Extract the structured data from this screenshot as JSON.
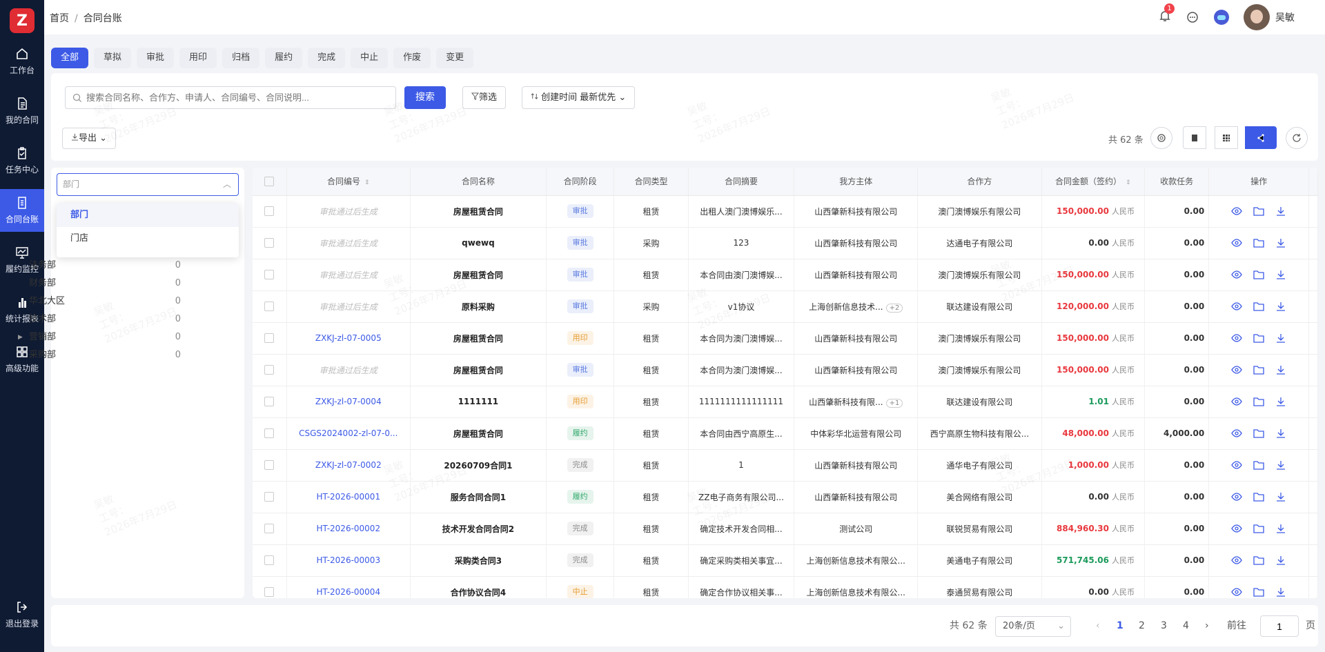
{
  "sidebar": {
    "items": [
      {
        "label": "工作台",
        "icon": "home-icon"
      },
      {
        "label": "我的合同",
        "icon": "document-icon"
      },
      {
        "label": "任务中心",
        "icon": "clipboard-icon"
      },
      {
        "label": "合同台账",
        "icon": "ledger-icon",
        "active": true
      },
      {
        "label": "履约监控",
        "icon": "monitor-icon"
      },
      {
        "label": "统计报表",
        "icon": "bar-chart-icon"
      },
      {
        "label": "高级功能",
        "icon": "grid-icon"
      }
    ],
    "logout": "退出登录"
  },
  "header": {
    "crumb_home": "首页",
    "crumb_sep": "/",
    "crumb_current": "合同台账",
    "notify_count": "1",
    "user_name": "吴敏"
  },
  "tabs": [
    "全部",
    "草拟",
    "审批",
    "用印",
    "归档",
    "履约",
    "完成",
    "中止",
    "作废",
    "变更"
  ],
  "toolbar": {
    "search_placeholder": "搜索合同名称、合作方、申请人、合同编号、合同说明...",
    "search_btn": "搜索",
    "filter_btn": "筛选",
    "sort_btn": "创建时间 最新优先",
    "export_btn": "导出",
    "total": "共 62 条"
  },
  "dept": {
    "placeholder": "部门",
    "options": [
      "部门",
      "门店"
    ],
    "tree": [
      {
        "label": "法务部",
        "count": "0"
      },
      {
        "label": "财务部",
        "count": "0"
      },
      {
        "label": "华北大区",
        "count": "0"
      },
      {
        "label": "技术部",
        "count": "0"
      },
      {
        "label": "营销部",
        "count": "0",
        "expandable": true
      },
      {
        "label": "采购部",
        "count": "0"
      }
    ]
  },
  "table": {
    "headers": [
      "合同编号",
      "合同名称",
      "合同阶段",
      "合同类型",
      "合同摘要",
      "我方主体",
      "合作方",
      "合同金额（签约）",
      "收款任务",
      "操作"
    ],
    "currency": "人民币",
    "rows": [
      {
        "code": "审批通过后生成",
        "pending": true,
        "name": "房屋租赁合同",
        "stage": "审批",
        "type": "租赁",
        "summary": "出租人澳门澳博娱乐...",
        "party": "山西肇新科技有限公司",
        "partner": "澳门澳博娱乐有限公司",
        "amount": "150,000.00",
        "amt_color": "#e8383d",
        "recv": "0.00"
      },
      {
        "code": "审批通过后生成",
        "pending": true,
        "name": "qwewq",
        "stage": "审批",
        "type": "采购",
        "summary": "123",
        "party": "山西肇新科技有限公司",
        "partner": "达通电子有限公司",
        "amount": "0.00",
        "amt_color": "#333",
        "recv": "0.00"
      },
      {
        "code": "审批通过后生成",
        "pending": true,
        "name": "房屋租赁合同",
        "stage": "审批",
        "type": "租赁",
        "summary": "本合同由澳门澳博娱...",
        "party": "山西肇新科技有限公司",
        "partner": "澳门澳博娱乐有限公司",
        "amount": "150,000.00",
        "amt_color": "#e8383d",
        "recv": "0.00"
      },
      {
        "code": "审批通过后生成",
        "pending": true,
        "name": "原料采购",
        "stage": "审批",
        "type": "采购",
        "summary": "v1协议",
        "party": "上海创新信息技术...",
        "party_more": "+2",
        "partner": "联达建设有限公司",
        "amount": "120,000.00",
        "amt_color": "#e8383d",
        "recv": "0.00"
      },
      {
        "code": "ZXKJ-zl-07-0005",
        "name": "房屋租赁合同",
        "stage": "用印",
        "type": "租赁",
        "summary": "本合同为澳门澳博娱...",
        "party": "山西肇新科技有限公司",
        "partner": "澳门澳博娱乐有限公司",
        "amount": "150,000.00",
        "amt_color": "#e8383d",
        "recv": "0.00"
      },
      {
        "code": "审批通过后生成",
        "pending": true,
        "name": "房屋租赁合同",
        "stage": "审批",
        "type": "租赁",
        "summary": "本合同为澳门澳博娱...",
        "party": "山西肇新科技有限公司",
        "partner": "澳门澳博娱乐有限公司",
        "amount": "150,000.00",
        "amt_color": "#e8383d",
        "recv": "0.00"
      },
      {
        "code": "ZXKJ-zl-07-0004",
        "name": "1111111",
        "stage": "用印",
        "type": "租赁",
        "summary": "1111111111111111",
        "party": "山西肇新科技有限...",
        "party_more": "+1",
        "partner": "联达建设有限公司",
        "amount": "1.01",
        "amt_color": "#1a9a5a",
        "recv": "0.00"
      },
      {
        "code": "CSGS2024002-zl-07-0...",
        "name": "房屋租赁合同",
        "stage": "履约",
        "type": "租赁",
        "summary": "本合同由西宁高原生...",
        "party": "中体彩华北运营有限公司",
        "partner": "西宁高原生物科技有限公...",
        "amount": "48,000.00",
        "amt_color": "#e8383d",
        "recv": "4,000.00"
      },
      {
        "code": "ZXKJ-zl-07-0002",
        "name": "20260709合同1",
        "stage": "完成",
        "type": "租赁",
        "summary": "1",
        "party": "山西肇新科技有限公司",
        "partner": "通华电子有限公司",
        "amount": "1,000.00",
        "amt_color": "#e8383d",
        "recv": "0.00"
      },
      {
        "code": "HT-2026-00001",
        "name": "服务合同合同1",
        "stage": "履约",
        "type": "租赁",
        "summary": "ZZ电子商务有限公司...",
        "party": "山西肇新科技有限公司",
        "partner": "美合网络有限公司",
        "amount": "0.00",
        "amt_color": "#333",
        "recv": "0.00"
      },
      {
        "code": "HT-2026-00002",
        "name": "技术开发合同合同2",
        "stage": "完成",
        "type": "租赁",
        "summary": "确定技术开发合同相...",
        "party": "测试公司",
        "partner": "联锐贸易有限公司",
        "amount": "884,960.30",
        "amt_color": "#e8383d",
        "recv": "0.00"
      },
      {
        "code": "HT-2026-00003",
        "name": "采购类合同3",
        "stage": "完成",
        "type": "租赁",
        "summary": "确定采购类相关事宜...",
        "party": "上海创新信息技术有限公...",
        "partner": "美通电子有限公司",
        "amount": "571,745.06",
        "amt_color": "#1a9a5a",
        "recv": "0.00"
      },
      {
        "code": "HT-2026-00004",
        "name": "合作协议合同4",
        "stage": "中止",
        "type": "租赁",
        "summary": "确定合作协议相关事...",
        "party": "上海创新信息技术有限公...",
        "partner": "泰通贸易有限公司",
        "amount": "0.00",
        "amt_color": "#333",
        "recv": "0.00"
      }
    ]
  },
  "stage_colors": {
    "审批": "#5b7be0",
    "用印": "#e69a2e",
    "履约": "#2fa86a",
    "完成": "#8c8c8c",
    "中止": "#e69a2e"
  },
  "pager": {
    "total": "共 62 条",
    "page_size": "20条/页",
    "pages": [
      "1",
      "2",
      "3",
      "4"
    ],
    "goto_label": "前往",
    "goto_value": "1",
    "page_suffix": "页"
  },
  "watermark": {
    "line1": "吴敏",
    "line2": "工号：",
    "line3": "2026年7月29日"
  }
}
